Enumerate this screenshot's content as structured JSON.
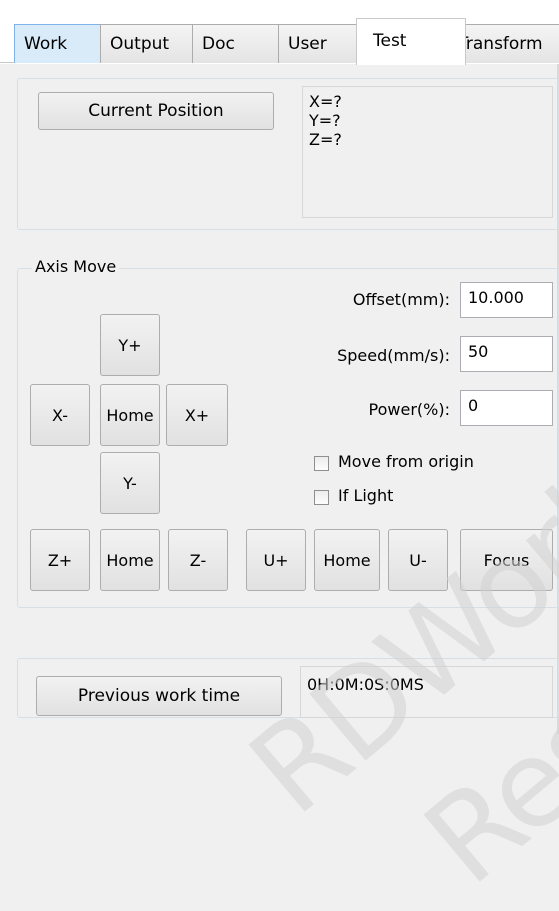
{
  "tabs": [
    {
      "label": "Work"
    },
    {
      "label": "Output"
    },
    {
      "label": "Doc"
    },
    {
      "label": "User"
    },
    {
      "label": "Test"
    },
    {
      "label": "Transform"
    }
  ],
  "position": {
    "button_label": "Current Position",
    "readout": "X=?\nY=?\nZ=?"
  },
  "axis_move": {
    "title": "Axis Move",
    "offset_label": "Offset(mm):",
    "offset_value": "10.000",
    "speed_label": "Speed(mm/s):",
    "speed_value": "50",
    "power_label": "Power(%):",
    "power_value": "0",
    "move_from_origin_label": "Move from origin",
    "if_light_label": "If Light",
    "buttons": {
      "y_plus": "Y+",
      "y_minus": "Y-",
      "x_minus": "X-",
      "x_plus": "X+",
      "home_xy": "Home",
      "z_plus": "Z+",
      "home_z": "Home",
      "z_minus": "Z-",
      "u_plus": "U+",
      "home_u": "Home",
      "u_minus": "U-",
      "focus": "Focus"
    }
  },
  "work_time": {
    "button_label": "Previous work time",
    "value": "0H:0M:0S:0MS"
  },
  "watermark": {
    "line1": "RDWorks",
    "line2": "Res"
  }
}
